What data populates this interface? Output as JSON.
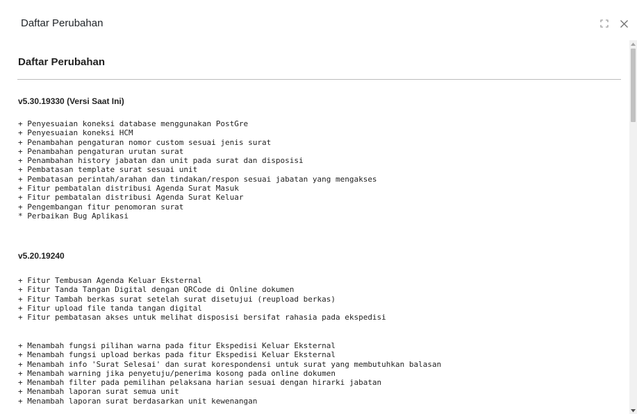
{
  "modal": {
    "title": "Daftar Perubahan"
  },
  "content": {
    "heading": "Daftar Perubahan",
    "sections": [
      {
        "version": "v5.30.19330 (Versi Saat Ini)",
        "groups": [
          [
            "+ Penyesuaian koneksi database menggunakan PostGre",
            "+ Penyesuaian koneksi HCM",
            "+ Penambahan pengaturan nomor custom sesuai jenis surat",
            "+ Penambahan pengaturan urutan surat",
            "+ Penambahan history jabatan dan unit pada surat dan disposisi",
            "+ Pembatasan template surat sesuai unit",
            "+ Pembatasan perintah/arahan dan tindakan/respon sesuai jabatan yang mengakses",
            "+ Fitur pembatalan distribusi Agenda Surat Masuk",
            "+ Fitur pembatalan distribusi Agenda Surat Keluar",
            "+ Pengembangan fitur penomoran surat",
            "* Perbaikan Bug Aplikasi"
          ]
        ]
      },
      {
        "version": "v5.20.19240",
        "groups": [
          [
            "+ Fitur Tembusan Agenda Keluar Eksternal",
            "+ Fitur Tanda Tangan Digital dengan QRCode di Online dokumen",
            "+ Fitur Tambah berkas surat setelah surat disetujui (reupload berkas)",
            "+ Fitur upload file tanda tangan digital",
            "+ Fitur pembatasan akses untuk melihat disposisi bersifat rahasia pada ekspedisi"
          ],
          [
            "+ Menambah fungsi pilihan warna pada fitur Ekspedisi Keluar Eksternal",
            "+ Menambah fungsi upload berkas pada fitur Ekspedisi Keluar Eksternal",
            "+ Menambah info 'Surat Selesai' dan surat korespondensi untuk surat yang membutuhkan balasan",
            "+ Menambah warning jika penyetuju/penerima kosong pada online dokumen",
            "+ Menambah filter pada pemilihan pelaksana harian sesuai dengan hirarki jabatan",
            "+ Menambah laporan surat semua unit",
            "+ Menambah laporan surat berdasarkan unit kewenangan"
          ]
        ]
      }
    ]
  },
  "icons": {
    "maximize": "maximize-icon",
    "close": "close-icon",
    "scroll_up": "scroll-up-arrow-icon",
    "scroll_down": "scroll-down-arrow-icon"
  },
  "colors": {
    "text": "#222222",
    "divider": "#bcbcbc",
    "scroll_track": "#f1f1f1",
    "scroll_thumb": "#c1c1c1"
  }
}
